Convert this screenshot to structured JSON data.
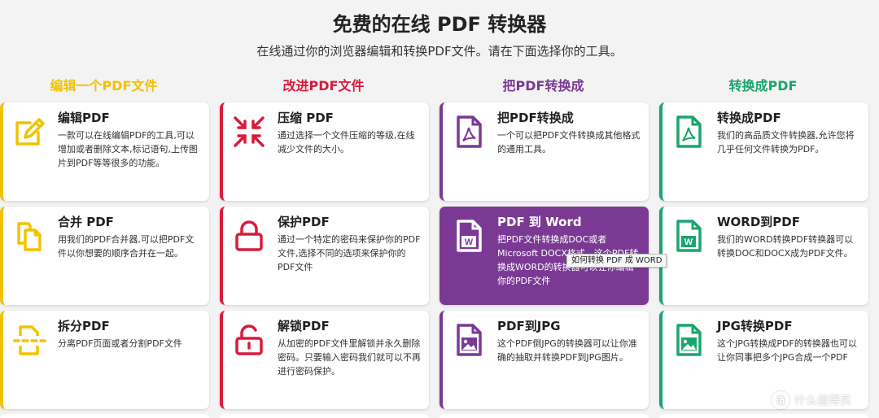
{
  "hero": {
    "title": "免费的在线 PDF 转换器",
    "subtitle": "在线通过你的浏览器编辑和转换PDF文件。请在下面选择你的工具。"
  },
  "colors": {
    "edit": "#f2c200",
    "improve": "#d81b3c",
    "from_pdf": "#7a3a94",
    "to_pdf": "#1aa56f"
  },
  "columns": [
    {
      "heading": "编辑一个PDF文件",
      "color": "#f2c200",
      "cards": [
        {
          "title": "编辑PDF",
          "desc": "一款可以在线编辑PDF的工具,可以增加或者删除文本,标记语句,上传图片到PDF等等很多的功能。",
          "icon": "pencil-edit-icon"
        },
        {
          "title": "合并 PDF",
          "desc": "用我们的PDF合并器,可以把PDF文件以你想要的顺序合并在一起。",
          "icon": "merge-documents-icon"
        },
        {
          "title": "拆分PDF",
          "desc": "分离PDF页面或者分割PDF文件",
          "icon": "split-document-icon"
        }
      ]
    },
    {
      "heading": "改进PDF文件",
      "color": "#d81b3c",
      "cards": [
        {
          "title": "压缩 PDF",
          "desc": "通过选择一个文件压缩的等级,在线减少文件的大小。",
          "icon": "compress-arrows-icon"
        },
        {
          "title": "保护PDF",
          "desc": "通过一个特定的密码来保护你的PDF文件,选择不同的选项来保护你的PDF文件",
          "icon": "lock-closed-icon"
        },
        {
          "title": "解锁PDF",
          "desc": "从加密的PDF文件里解锁并永久删除密码。只要输入密码我们就可以不再进行密码保护。",
          "icon": "lock-open-icon"
        }
      ]
    },
    {
      "heading": "把PDF转换成",
      "color": "#7a3a94",
      "cards": [
        {
          "title": "把PDF转换成",
          "desc": "一个可以把PDF文件转换成其他格式的通用工具。",
          "icon": "pdf-file-icon"
        },
        {
          "title": "PDF 到 Word",
          "desc": "把PDF文件转换成DOC或者Microsoft DOCX格式。这个PDF转换成WORD的转换器可以让你编辑你的PDF文件",
          "icon": "word-file-icon"
        },
        {
          "title": "PDF到JPG",
          "desc": "这个PDF倒JPG的转换器可以让你准确的抽取并转换PDF到JPG图片。",
          "icon": "image-file-icon"
        }
      ]
    },
    {
      "heading": "转换成PDF",
      "color": "#1aa56f",
      "cards": [
        {
          "title": "转换成PDF",
          "desc": "我们的高品质文件转换器,允许您将几乎任何文件转换为PDF。",
          "icon": "pdf-file-icon"
        },
        {
          "title": "WORD到PDF",
          "desc": "我们的WORD转换PDF转换器可以转换DOC和DOCX成为PDF文件。",
          "icon": "word-file-icon"
        },
        {
          "title": "JPG转换PDF",
          "desc": "这个JPG转换成PDF的转换器也可以让你同事把多个JPG合成一个PDF",
          "icon": "image-file-icon"
        }
      ]
    }
  ],
  "tooltip": {
    "text": "如何转换 PDF 成 WORD"
  },
  "watermark": {
    "badge": "值",
    "text": "什么值得买"
  }
}
